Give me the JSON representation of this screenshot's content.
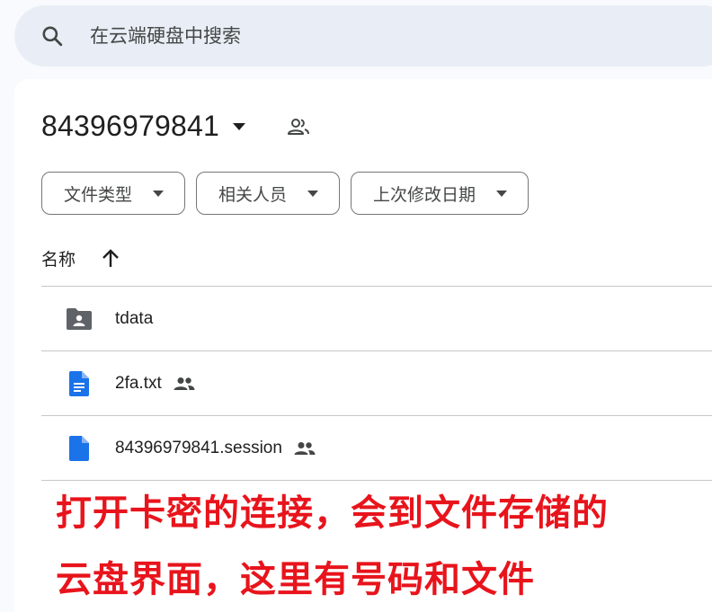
{
  "search": {
    "placeholder": "在云端硬盘中搜索",
    "icon": "search-icon"
  },
  "header": {
    "title": "84396979841",
    "caret_icon": "caret-down-icon",
    "shared_icon": "people-outline-icon"
  },
  "filters": [
    {
      "label": "文件类型"
    },
    {
      "label": "相关人员"
    },
    {
      "label": "上次修改日期"
    }
  ],
  "sort": {
    "label": "名称",
    "direction_icon": "arrow-up-icon"
  },
  "files": [
    {
      "name": "tdata",
      "type": "shared-folder",
      "shared": false
    },
    {
      "name": "2fa.txt",
      "type": "document",
      "shared": true
    },
    {
      "name": "84396979841.session",
      "type": "file",
      "shared": true
    }
  ],
  "annotation": {
    "line1": "打开卡密的连接，会到文件存储的",
    "line2": "云盘界面，这里有号码和文件",
    "color": "#e8141c"
  },
  "colors": {
    "accent_blue": "#1a73e8",
    "folder_gray": "#5f6368",
    "search_bg": "#e9eef6"
  }
}
